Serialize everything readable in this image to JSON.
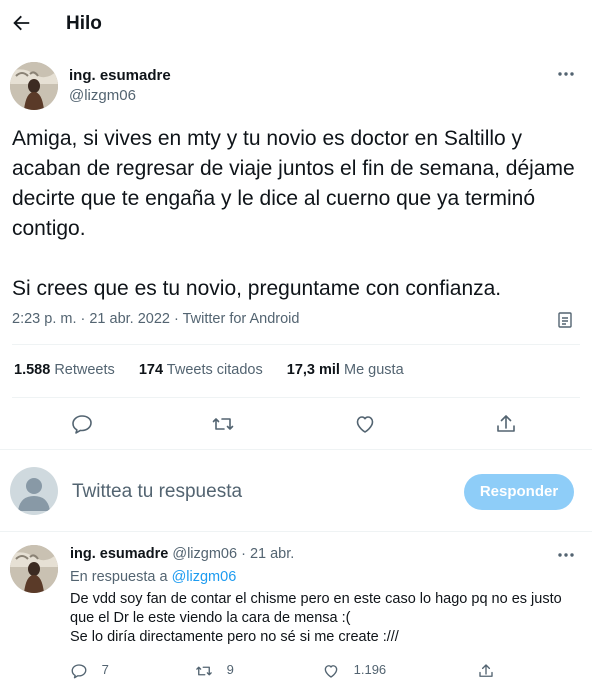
{
  "header": {
    "title": "Hilo",
    "back_icon": "arrow-left-icon"
  },
  "tweet": {
    "author_name": "ing. esumadre",
    "author_handle": "@lizgm06",
    "text": "Amiga, si vives en mty y tu novio es doctor en Saltillo y acaban de regresar de viaje juntos el fin de semana, déjame decirte que te engaña y le dice al cuerno que ya terminó contigo.\n\nSi crees que es tu novio, preguntame con confianza.",
    "meta": "2:23 p. m. · 21 abr. 2022 · Twitter for Android",
    "stats": {
      "retweets_count": "1.588",
      "retweets_label": "Retweets",
      "quotes_count": "174",
      "quotes_label": "Tweets citados",
      "likes_count": "17,3 mil",
      "likes_label": "Me gusta"
    }
  },
  "compose": {
    "placeholder": "Twittea tu respuesta",
    "button_label": "Responder"
  },
  "reply": {
    "author_name": "ing. esumadre",
    "author_handle": "@lizgm06",
    "separator": "·",
    "date": "21 abr.",
    "in_reply_prefix": "En respuesta a",
    "in_reply_handle": "@lizgm06",
    "text": "De vdd soy fan de contar el chisme pero en este caso lo hago pq no es justo que el Dr le este viendo la cara de mensa :(\nSe lo diría directamente pero no sé si me create :///",
    "replies": "7",
    "retweets": "9",
    "likes": "1.196"
  },
  "colors": {
    "accent": "#1d9bf0",
    "button_disabled": "#8ecdf8",
    "muted": "#536471"
  }
}
